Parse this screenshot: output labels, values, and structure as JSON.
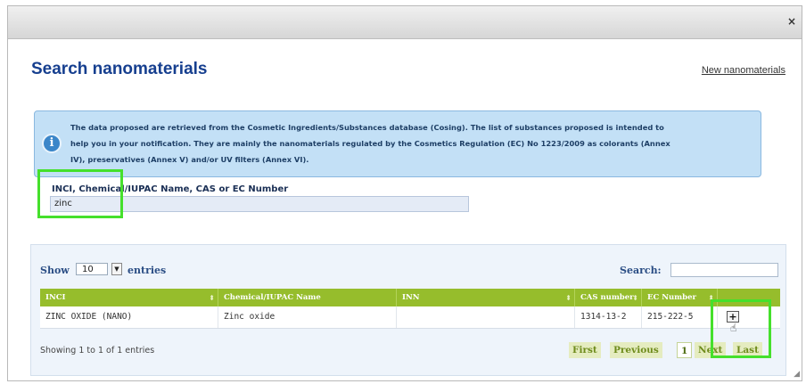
{
  "dialog": {
    "close_label": "×"
  },
  "header": {
    "title": "Search nanomaterials",
    "new_link": "New nanomaterials"
  },
  "info": {
    "icon": "info-icon",
    "line1": "The data proposed are retrieved from the Cosmetic Ingredients/Substances database (Cosing). The list of substances proposed is intended to",
    "line2": "help you in your notification. They are mainly the nanomaterials regulated by the Cosmetics Regulation (EC) No 1223/2009 as colorants (Annex",
    "line3": "IV), preservatives (Annex V) and/or UV filters (Annex VI)."
  },
  "search_field": {
    "label": "INCI, Chemical/IUPAC Name, CAS or EC Number",
    "value": "zinc"
  },
  "table_controls": {
    "show_label": "Show",
    "entries_value": "10",
    "entries_label": "entries",
    "search_label": "Search:",
    "search_value": ""
  },
  "table": {
    "columns": [
      "INCI",
      "Chemical/IUPAC Name",
      "INN",
      "CAS number",
      "EC Number",
      ""
    ],
    "rows": [
      {
        "inci": "ZINC OXIDE (NANO)",
        "chemical": "Zinc oxide",
        "inn": "",
        "cas": "1314-13-2",
        "ec": "215-222-5",
        "action": "+"
      }
    ]
  },
  "footer": {
    "showing": "Showing 1 to 1 of 1 entries",
    "pagination": [
      "First",
      "Previous",
      "1",
      "Next",
      "Last"
    ]
  },
  "highlight_color": "#45e02c"
}
